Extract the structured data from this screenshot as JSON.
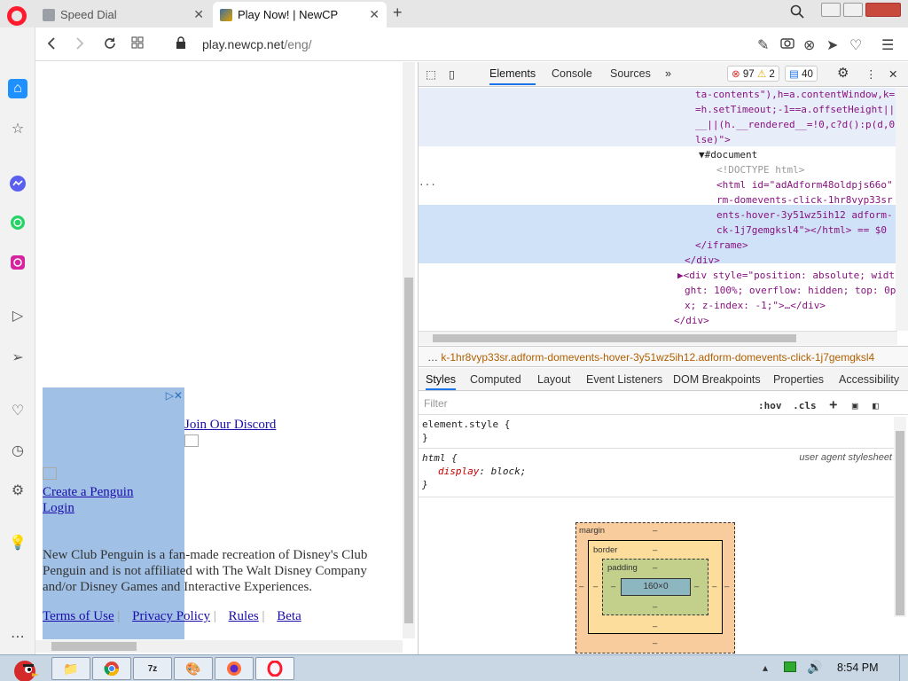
{
  "browser": {
    "tabs": [
      {
        "title": "Speed Dial",
        "active": false
      },
      {
        "title": "Play Now! | NewCP",
        "active": true
      }
    ],
    "address": {
      "host": "play.newcp.net",
      "path": "/eng/"
    }
  },
  "page": {
    "ad_label": "▷✕",
    "links": {
      "discord": "Join Our Discord",
      "create_penguin": "Create a Penguin",
      "login": "Login"
    },
    "disclaimer": "New Club Penguin is a fan-made recreation of Disney's Club Penguin and is not affiliated with The Walt Disney Company and/or Disney Games and Interactive Experiences.",
    "footer": {
      "terms": "Terms of Use",
      "privacy": "Privacy Policy",
      "rules": "Rules",
      "beta": "Beta"
    }
  },
  "devtools": {
    "tabs": [
      "Elements",
      "Console",
      "Sources"
    ],
    "more": "»",
    "counts": {
      "errors": "97",
      "warnings": "2",
      "messages": "40"
    },
    "dom_lines": [
      "ta-contents\"),h=a.contentWindow,k=",
      "=h.setTimeout;-1==a.offsetHeight||",
      "__||(h.__rendered__=!0,c?d():p(d,0",
      "lse)\">",
      "▼#document",
      "<!DOCTYPE html>",
      "<html id=\"adAdform48oldpjs66o\"",
      "rm-domevents-click-1hr8vyp33sr",
      "ents-hover-3y51wz5ih12 adform-",
      "ck-1j7gemgksl4\"></html> == $0",
      "</iframe>",
      "</div>",
      "▶<div style=\"position: absolute; widt",
      "ght: 100%; overflow: hidden; top: 0p",
      "x; z-index: -1;\">…</div>",
      "</div>"
    ],
    "breadcrumb": "k-1hr8vyp33sr.adform-domevents-hover-3y51wz5ih12.adform-domevents-click-1j7gemgksl4",
    "breadcrumb_more": "…",
    "sub_tabs": [
      "Styles",
      "Computed",
      "Layout",
      "Event Listeners",
      "DOM Breakpoints",
      "Properties",
      "Accessibility"
    ],
    "filter": {
      "placeholder": "Filter",
      "hov": ":hov",
      "cls": ".cls",
      "add": "+"
    },
    "rules": {
      "element_style": "element.style {",
      "close": "}",
      "html_selector": "html {",
      "html_prop": "display",
      "html_val": "block;",
      "html_source": "user agent stylesheet"
    },
    "box_model": {
      "margin_label": "margin",
      "border_label": "border",
      "padding_label": "padding",
      "content": "160×0",
      "dash": "–"
    }
  },
  "taskbar": {
    "clock": "8:54 PM"
  }
}
